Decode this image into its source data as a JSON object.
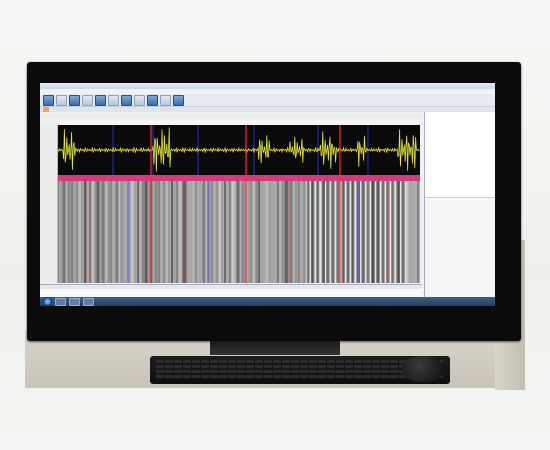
{
  "window": {
    "title": "",
    "title_right": ""
  },
  "menu": [],
  "tabs": [
    {
      "label": ""
    }
  ],
  "options_row": [],
  "markers": [],
  "bottom_panel": {
    "tabs": [],
    "columns": [],
    "rows": []
  },
  "right_panel": {
    "tree": [],
    "properties": []
  },
  "colors": {
    "waveform": "#e6e63a",
    "cursor_red": "#ff2a2a",
    "cursor_blue": "#2a35ff",
    "scan_band": "#d63a7e",
    "taskbar": "#2a4a72"
  },
  "monitor": {
    "brand": ""
  }
}
